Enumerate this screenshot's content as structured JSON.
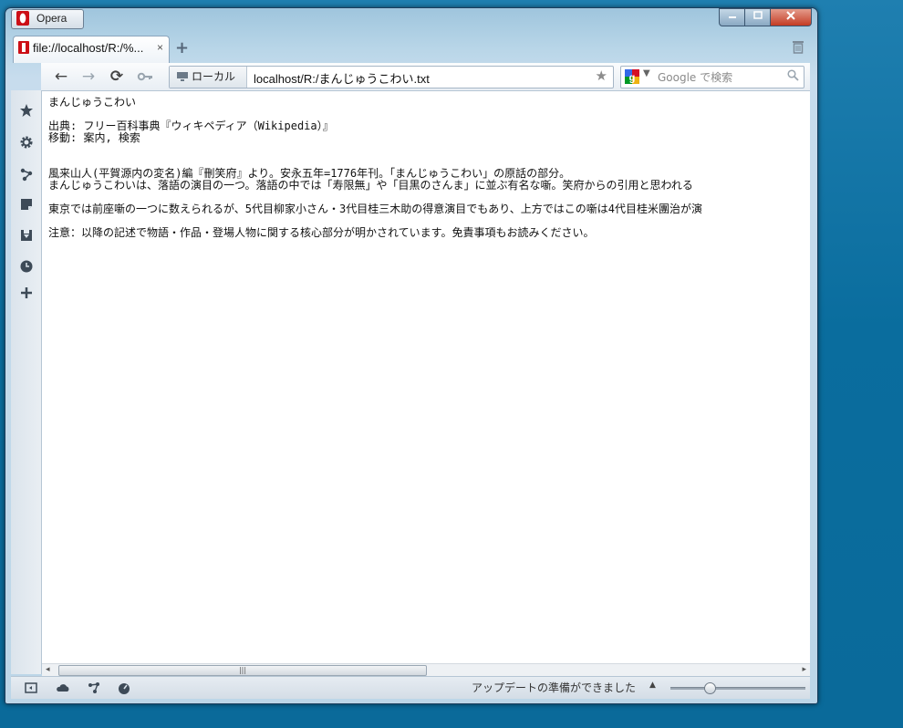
{
  "window": {
    "menu_button": "Opera"
  },
  "tabs": [
    {
      "title": "file://localhost/R:/%...",
      "close": "×"
    }
  ],
  "new_tab_symbol": "+",
  "address_bar": {
    "site_label": "ローカル",
    "url": "localhost/R:/まんじゅうこわい.txt"
  },
  "search": {
    "placeholder": "Google で検索"
  },
  "nav": {
    "back": "←",
    "forward": "→",
    "reload": "⟳"
  },
  "content": {
    "lines": [
      "まんじゅうこわい",
      "",
      "出典: フリー百科事典『ウィキペディア（Wikipedia）』",
      "移動: 案内, 検索",
      "",
      "",
      "風来山人(平賀源内の変名)編『刪笑府』より。安永五年=1776年刊。「まんじゅうこわい」の原話の部分。",
      "まんじゅうこわいは、落語の演目の一つ。落語の中では「寿限無」や「目黒のさんま」に並ぶ有名な噺。笑府からの引用と思われる",
      "",
      "東京では前座噺の一つに数えられるが、5代目柳家小さん・3代目桂三木助の得意演目でもあり、上方ではこの噺は4代目桂米團治が演",
      "",
      "注意：以降の記述で物語・作品・登場人物に関する核心部分が明かされています。免責事項もお読みください。"
    ]
  },
  "status": {
    "text": "アップデートの準備ができました",
    "arrow": "▲",
    "zoom_fraction": 0.27
  },
  "scrollbar": {
    "left_arrow": "◂",
    "right_arrow": "▸",
    "grip": "|||"
  },
  "colors": {
    "opera_red": "#cc0f16",
    "desktop_blue": "#0a6d9e",
    "close_red": "#c43c24"
  },
  "icons": {
    "sidepanel": [
      "star-icon",
      "gear-icon",
      "share-icon",
      "note-icon",
      "download-icon",
      "history-icon",
      "add-icon"
    ],
    "statusbar": [
      "panel-toggle-icon",
      "cloud-icon",
      "unite-icon",
      "speedometer-icon"
    ]
  }
}
